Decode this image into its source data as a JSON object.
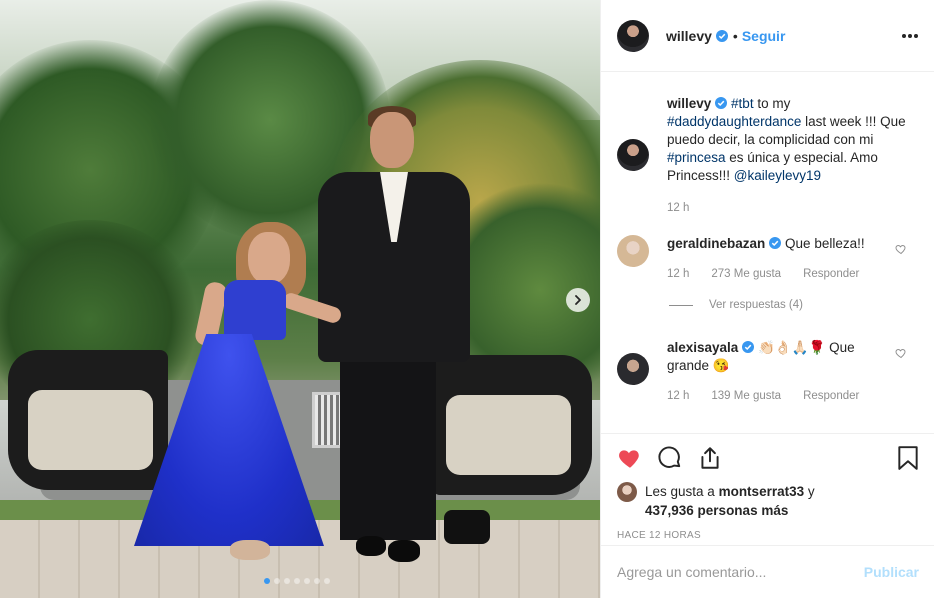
{
  "post": {
    "author": "willevy",
    "follow_label": "Seguir",
    "bullet": "•",
    "carousel": {
      "total_slides": 7,
      "active_slide": 1
    }
  },
  "caption": {
    "author": "willevy",
    "text_parts": [
      "#tbt",
      " to my ",
      "#daddydaughterdance",
      " last week !!! Que puedo decir, la complicidad con mi ",
      "#princesa",
      " es única y especial. Amo Princess!!! ",
      "@kaileylevy19"
    ],
    "time": "12 h"
  },
  "comments": [
    {
      "author": "geraldinebazan",
      "text": "Que belleza!!",
      "time": "12 h",
      "likes": "273 Me gusta",
      "reply_label": "Responder",
      "view_replies": "Ver respuestas (4)"
    },
    {
      "author": "alexisayala",
      "emoji": "👏🏻👌🏻🙏🏻🌹",
      "text": " Que grande ",
      "emoji_end": "😘",
      "time": "12 h",
      "likes": "139 Me gusta",
      "reply_label": "Responder"
    }
  ],
  "likes_line": {
    "prefix": "Les gusta a ",
    "user": "montserrat33",
    "middle": " y ",
    "count": "437,936 personas más"
  },
  "time_ago": "HACE 12 HORAS",
  "add_comment": {
    "placeholder": "Agrega un comentario...",
    "publish_label": "Publicar"
  },
  "colors": {
    "accent": "#3897f0",
    "like_red": "#ed4956",
    "tag": "#003569",
    "muted": "#8e8e8e"
  },
  "icons": [
    "verified-icon",
    "more-icon",
    "heart-icon",
    "comment-icon",
    "share-icon",
    "bookmark-icon",
    "chevron-right-icon"
  ]
}
